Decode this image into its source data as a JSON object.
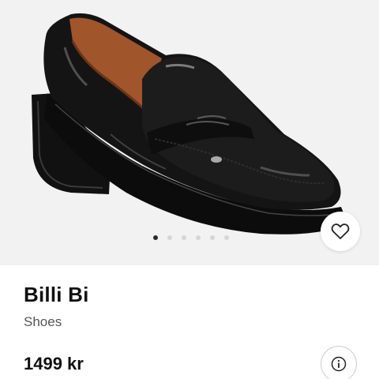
{
  "product": {
    "brand": "Billi Bi",
    "category": "Shoes",
    "price": "1499 kr"
  },
  "carousel": {
    "total_images": 6,
    "active_index": 0
  },
  "icons": {
    "favorite": "heart-icon",
    "info": "info-icon"
  },
  "colors": {
    "image_background": "#f2f2f2",
    "text_primary": "#111111",
    "text_secondary": "#555555",
    "active_dot": "#2a2a2a"
  }
}
